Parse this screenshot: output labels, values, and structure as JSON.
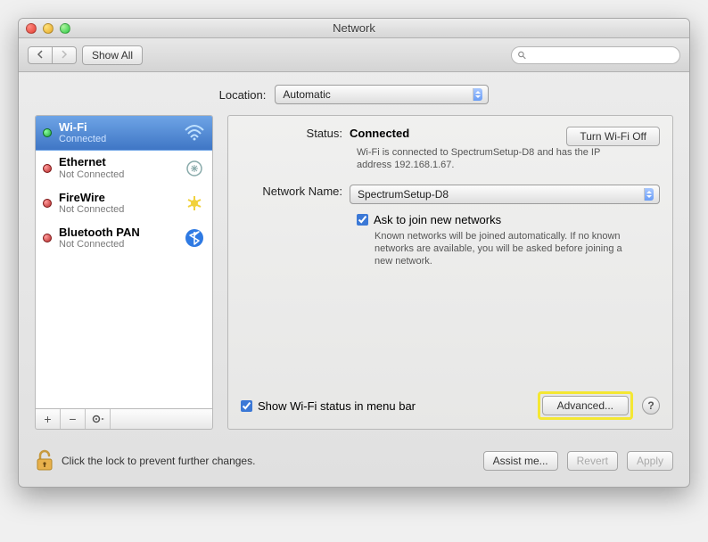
{
  "title": "Network",
  "toolbar": {
    "show_all": "Show All",
    "search_placeholder": ""
  },
  "location": {
    "label": "Location:",
    "value": "Automatic"
  },
  "sidebar": {
    "items": [
      {
        "name": "Wi-Fi",
        "status": "Connected",
        "dot": "green"
      },
      {
        "name": "Ethernet",
        "status": "Not Connected",
        "dot": "red"
      },
      {
        "name": "FireWire",
        "status": "Not Connected",
        "dot": "red"
      },
      {
        "name": "Bluetooth PAN",
        "status": "Not Connected",
        "dot": "red"
      }
    ]
  },
  "detail": {
    "status_label": "Status:",
    "status_value": "Connected",
    "wifi_off_btn": "Turn Wi-Fi Off",
    "status_desc": "Wi-Fi is connected to SpectrumSetup-D8 and has the IP address 192.168.1.67.",
    "network_name_label": "Network Name:",
    "network_name_value": "SpectrumSetup-D8",
    "ask_join": "Ask to join new networks",
    "ask_desc": "Known networks will be joined automatically. If no known networks are available, you will be asked before joining a new network.",
    "show_menubar": "Show Wi-Fi status in menu bar",
    "advanced_btn": "Advanced..."
  },
  "footer": {
    "lock_text": "Click the lock to prevent further changes.",
    "assist": "Assist me...",
    "revert": "Revert",
    "apply": "Apply"
  }
}
